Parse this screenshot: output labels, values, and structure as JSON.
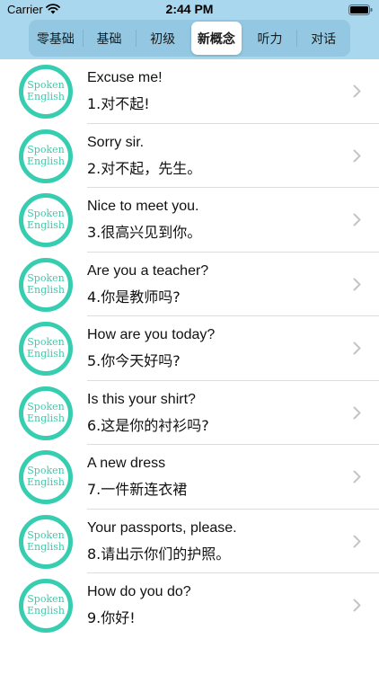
{
  "status_bar": {
    "carrier": "Carrier",
    "time": "2:44 PM"
  },
  "tabs": [
    {
      "label": "零基础"
    },
    {
      "label": "基础"
    },
    {
      "label": "初级"
    },
    {
      "label": "新概念",
      "selected": true
    },
    {
      "label": "听力"
    },
    {
      "label": "对话"
    }
  ],
  "avatar_logo": {
    "line1": "Spoken",
    "line2": "English",
    "color": "#36cdb0"
  },
  "lessons": [
    {
      "title": "Excuse me!",
      "subtitle": "1.对不起!"
    },
    {
      "title": "Sorry sir.",
      "subtitle": "2.对不起，先生。"
    },
    {
      "title": "Nice to meet you.",
      "subtitle": "3.很高兴见到你。"
    },
    {
      "title": "Are you a teacher?",
      "subtitle": "4.你是教师吗?"
    },
    {
      "title": "How are you today?",
      "subtitle": "5.你今天好吗?"
    },
    {
      "title": "Is this your shirt?",
      "subtitle": "6.这是你的衬衫吗?"
    },
    {
      "title": "A new dress",
      "subtitle": "7.一件新连衣裙"
    },
    {
      "title": "Your passports, please.",
      "subtitle": "8.请出示你们的护照。"
    },
    {
      "title": "How do you do?",
      "subtitle": "9.你好!"
    }
  ],
  "colors": {
    "header": "#a9d7ee",
    "accent": "#36cdb0"
  }
}
